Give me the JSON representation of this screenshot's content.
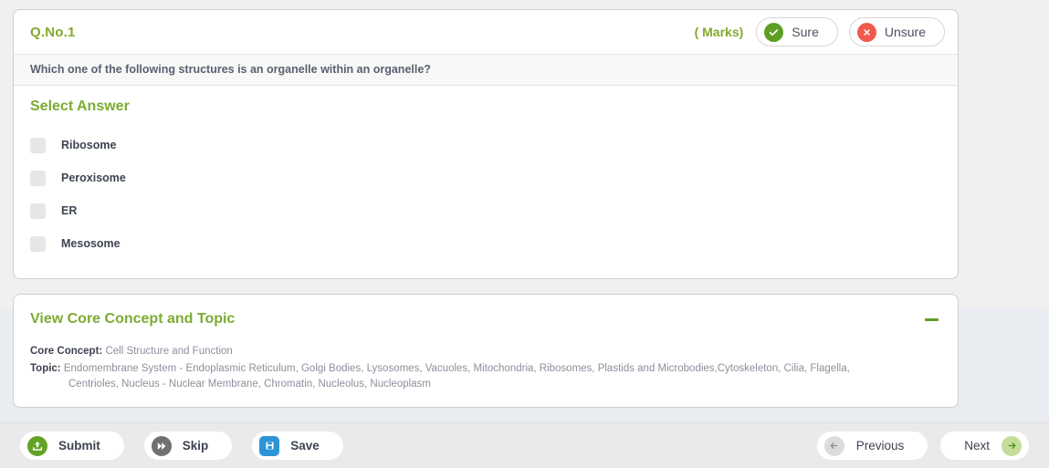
{
  "question": {
    "number_label": "Q.No.1",
    "marks_label": "( Marks)",
    "sure_label": "Sure",
    "unsure_label": "Unsure",
    "text": "Which one of the following structures is an organelle within an organelle?",
    "select_answer_label": "Select Answer",
    "options": [
      {
        "label": "Ribosome"
      },
      {
        "label": "Peroxisome"
      },
      {
        "label": "ER"
      },
      {
        "label": "Mesosome"
      }
    ]
  },
  "concept": {
    "title": "View Core Concept and Topic",
    "core_concept_key": "Core Concept:",
    "core_concept_value": "Cell Structure and Function",
    "topic_key": "Topic:",
    "topic_value_line1": "Endomembrane System - Endoplasmic Reticulum, Golgi Bodies, Lysosomes, Vacuoles, Mitochondria, Ribosomes, Plastids and Microbodies,Cytoskeleton, Cilia, Flagella,",
    "topic_value_line2": "Centrioles, Nucleus - Nuclear Membrane, Chromatin, Nucleolus, Nucleoplasm"
  },
  "footer": {
    "submit_label": "Submit",
    "skip_label": "Skip",
    "save_label": "Save",
    "previous_label": "Previous",
    "next_label": "Next"
  },
  "colors": {
    "accent_green": "#7cab33",
    "sure_green": "#5e9e23",
    "unsure_red": "#ef5a4c",
    "save_blue": "#2d95d6",
    "skip_gray": "#6f7070",
    "next_green": "#c4dd9b",
    "page_bg": "#f0f0f0",
    "panel_bg": "#e9edf2",
    "footer_bg": "#ebeaea"
  }
}
